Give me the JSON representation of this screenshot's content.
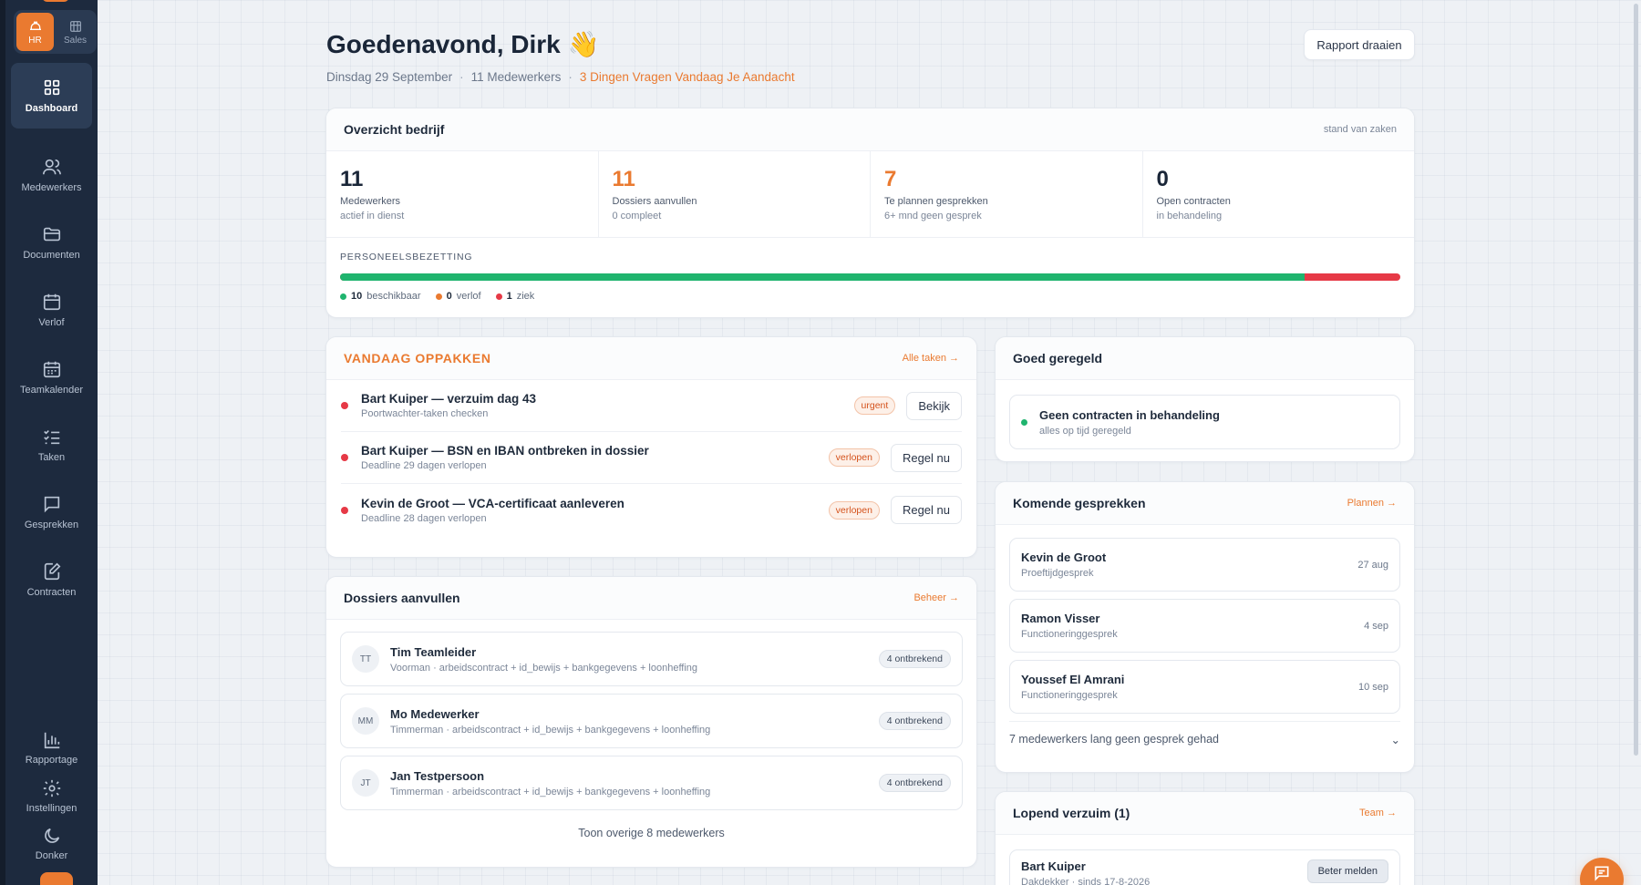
{
  "sidebar": {
    "modes": [
      {
        "label": "HR",
        "icon": "hard-hat-icon"
      },
      {
        "label": "Sales",
        "icon": "building-icon"
      }
    ],
    "nav": [
      {
        "label": "Dashboard",
        "icon": "grid-icon"
      },
      {
        "label": "Medewerkers",
        "icon": "users-icon"
      },
      {
        "label": "Documenten",
        "icon": "folder-icon"
      },
      {
        "label": "Verlof",
        "icon": "calendar-icon"
      },
      {
        "label": "Teamkalender",
        "icon": "calendar-days-icon"
      },
      {
        "label": "Taken",
        "icon": "checklist-icon"
      },
      {
        "label": "Gesprekken",
        "icon": "chat-icon"
      },
      {
        "label": "Contracten",
        "icon": "edit-file-icon"
      }
    ],
    "bottom": [
      {
        "label": "Rapportage",
        "icon": "bar-chart-icon"
      },
      {
        "label": "Instellingen",
        "icon": "gear-icon"
      },
      {
        "label": "Donker",
        "icon": "moon-icon"
      }
    ]
  },
  "header": {
    "greeting": "Goedenavond, Dirk 👋",
    "date": "Dinsdag 29 September",
    "sep": "·",
    "employees": "11 Medewerkers",
    "alert": "3 Dingen Vragen Vandaag Je Aandacht",
    "report_button": "Rapport draaien"
  },
  "overview": {
    "title": "Overzicht bedrijf",
    "meta": "stand van zaken",
    "stats": [
      {
        "value": "11",
        "label": "Medewerkers",
        "sub": "actief in dienst",
        "accent": false
      },
      {
        "value": "11",
        "label": "Dossiers aanvullen",
        "sub": "0 compleet",
        "accent": true
      },
      {
        "value": "7",
        "label": "Te plannen gesprekken",
        "sub": "6+ mnd geen gesprek",
        "accent": true
      },
      {
        "value": "0",
        "label": "Open contracten",
        "sub": "in behandeling",
        "accent": false
      }
    ],
    "occupancy": {
      "title": "PERSONEELSBEZETTING",
      "available_fraction": 0.91,
      "available_count": "10",
      "available_label": "beschikbaar",
      "leave_count": "0",
      "leave_label": "verlof",
      "sick_count": "1",
      "sick_label": "ziek",
      "colors": {
        "available": "#1fb46e",
        "leave": "#ea7a30",
        "sick": "#e63946"
      }
    }
  },
  "today": {
    "title": "VANDAAG OPPAKKEN",
    "link": "Alle taken →",
    "tasks": [
      {
        "title": "Bart Kuiper — verzuim dag 43",
        "sub": "Poortwachter-taken checken",
        "badge": "urgent",
        "action": "Bekijk"
      },
      {
        "title": "Bart Kuiper — BSN en IBAN ontbreken in dossier",
        "sub": "Deadline 29 dagen verlopen",
        "badge": "verlopen",
        "action": "Regel nu"
      },
      {
        "title": "Kevin de Groot — VCA-certificaat aanleveren",
        "sub": "Deadline 28 dagen verlopen",
        "badge": "verlopen",
        "action": "Regel nu"
      }
    ]
  },
  "dossiers": {
    "title": "Dossiers aanvullen",
    "link": "Beheer →",
    "rows": [
      {
        "initials": "TT",
        "name": "Tim Teamleider",
        "sub": "Voorman · arbeidscontract + id_bewijs + bankgegevens + loonheffing",
        "badge": "4 ontbrekend"
      },
      {
        "initials": "MM",
        "name": "Mo Medewerker",
        "sub": "Timmerman · arbeidscontract + id_bewijs + bankgegevens + loonheffing",
        "badge": "4 ontbrekend"
      },
      {
        "initials": "JT",
        "name": "Jan Testpersoon",
        "sub": "Timmerman · arbeidscontract + id_bewijs + bankgegevens + loonheffing",
        "badge": "4 ontbrekend"
      }
    ],
    "more": "Toon overige 8 medewerkers"
  },
  "good": {
    "title": "Goed geregeld",
    "item_title": "Geen contracten in behandeling",
    "item_sub": "alles op tijd geregeld"
  },
  "upcoming": {
    "title": "Komende gesprekken",
    "link": "Plannen →",
    "rows": [
      {
        "name": "Kevin de Groot",
        "type": "Proeftijdgesprek",
        "date": "27 aug"
      },
      {
        "name": "Ramon Visser",
        "type": "Functioneringgesprek",
        "date": "4 sep"
      },
      {
        "name": "Youssef El Amrani",
        "type": "Functioneringgesprek",
        "date": "10 sep"
      }
    ],
    "footer": "7 medewerkers lang geen gesprek gehad",
    "footer_icon": "⌄"
  },
  "absence": {
    "title": "Lopend verzuim (1)",
    "link": "Team →",
    "row_name": "Bart Kuiper",
    "row_sub": "Dakdekker · sinds 17-8-2026",
    "row_action": "Beter melden"
  }
}
